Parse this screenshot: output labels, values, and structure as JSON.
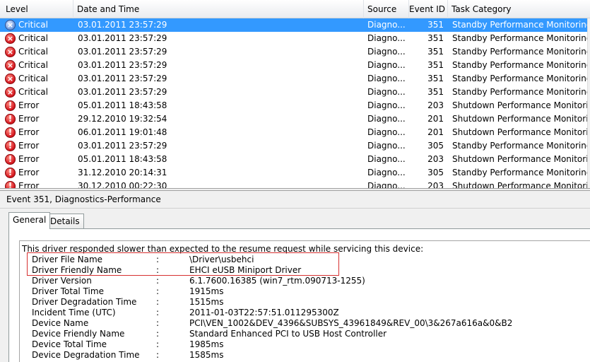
{
  "list": {
    "columns": {
      "level": "Level",
      "date": "Date and Time",
      "source": "Source",
      "event_id": "Event ID",
      "task_category": "Task Category"
    },
    "rows": [
      {
        "level": "Critical",
        "icon": "critical-icon",
        "date": "03.01.2011 23:57:29",
        "source": "Diagno...",
        "event_id": "351",
        "category": "Standby Performance Monitoring",
        "selected": true
      },
      {
        "level": "Critical",
        "icon": "critical-icon",
        "date": "03.01.2011 23:57:29",
        "source": "Diagno...",
        "event_id": "351",
        "category": "Standby Performance Monitoring"
      },
      {
        "level": "Critical",
        "icon": "critical-icon",
        "date": "03.01.2011 23:57:29",
        "source": "Diagno...",
        "event_id": "351",
        "category": "Standby Performance Monitoring"
      },
      {
        "level": "Critical",
        "icon": "critical-icon",
        "date": "03.01.2011 23:57:29",
        "source": "Diagno...",
        "event_id": "351",
        "category": "Standby Performance Monitoring"
      },
      {
        "level": "Critical",
        "icon": "critical-icon",
        "date": "03.01.2011 23:57:29",
        "source": "Diagno...",
        "event_id": "351",
        "category": "Standby Performance Monitoring"
      },
      {
        "level": "Critical",
        "icon": "critical-icon",
        "date": "03.01.2011 23:57:29",
        "source": "Diagno...",
        "event_id": "351",
        "category": "Standby Performance Monitoring"
      },
      {
        "level": "Error",
        "icon": "error-icon",
        "date": "05.01.2011 18:43:58",
        "source": "Diagno...",
        "event_id": "203",
        "category": "Shutdown Performance Monitoring"
      },
      {
        "level": "Error",
        "icon": "error-icon",
        "date": "29.12.2010 19:32:54",
        "source": "Diagno...",
        "event_id": "201",
        "category": "Shutdown Performance Monitoring"
      },
      {
        "level": "Error",
        "icon": "error-icon",
        "date": "06.01.2011 19:01:48",
        "source": "Diagno...",
        "event_id": "201",
        "category": "Shutdown Performance Monitoring"
      },
      {
        "level": "Error",
        "icon": "error-icon",
        "date": "03.01.2011 23:57:29",
        "source": "Diagno...",
        "event_id": "305",
        "category": "Standby Performance Monitoring"
      },
      {
        "level": "Error",
        "icon": "error-icon",
        "date": "05.01.2011 18:43:58",
        "source": "Diagno...",
        "event_id": "203",
        "category": "Shutdown Performance Monitoring"
      },
      {
        "level": "Error",
        "icon": "error-icon",
        "date": "31.12.2010 20:14:31",
        "source": "Diagno...",
        "event_id": "305",
        "category": "Standby Performance Monitoring"
      },
      {
        "level": "Error",
        "icon": "error-icon",
        "date": "30.12.2010 00:22:30",
        "source": "Diagno...",
        "event_id": "203",
        "category": "Shutdown Performance Monitoring"
      }
    ]
  },
  "detail": {
    "title": "Event 351, Diagnostics-Performance",
    "tabs": {
      "general": "General",
      "details": "Details"
    },
    "message": "This driver responded slower than expected to the resume request while servicing this device:",
    "properties": [
      {
        "name": "Driver File Name",
        "value": "\\Driver\\usbehci"
      },
      {
        "name": "Driver Friendly Name",
        "value": "EHCI eUSB Miniport Driver"
      },
      {
        "name": "Driver Version",
        "value": "6.1.7600.16385 (win7_rtm.090713-1255)"
      },
      {
        "name": "Driver Total Time",
        "value": "1915ms"
      },
      {
        "name": "Driver Degradation Time",
        "value": "1515ms"
      },
      {
        "name": "Incident Time (UTC)",
        "value": "2011-01-03T22:57:51.011295300Z"
      },
      {
        "name": "Device Name",
        "value": "PCI\\VEN_1002&DEV_4396&SUBSYS_43961849&REV_00\\3&267a616a&0&B2"
      },
      {
        "name": "Device Friendly Name",
        "value": "Standard Enhanced PCI to USB Host Controller"
      },
      {
        "name": "Device Total Time",
        "value": "1985ms"
      },
      {
        "name": "Device Degradation Time",
        "value": "1585ms"
      }
    ],
    "separator": ":"
  }
}
